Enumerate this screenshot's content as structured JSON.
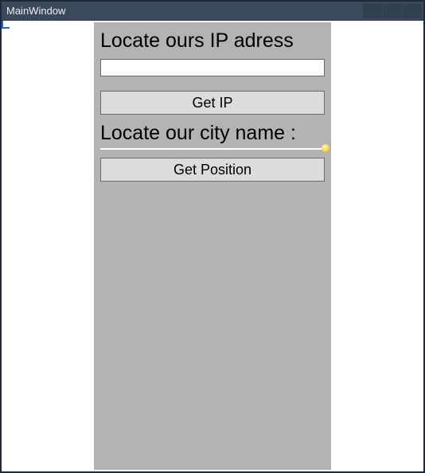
{
  "window": {
    "title": "MainWindow"
  },
  "form": {
    "ip_section_heading": "Locate ours IP adress",
    "ip_input_value": "",
    "ip_input_placeholder": "",
    "get_ip_button_label": "Get IP",
    "city_section_heading": "Locate our city name :",
    "get_position_button_label": "Get Position"
  },
  "colors": {
    "panel_bg": "#b3b3b3",
    "button_bg": "#dcdcdc",
    "titlebar_bg": "#3a4a5a"
  }
}
